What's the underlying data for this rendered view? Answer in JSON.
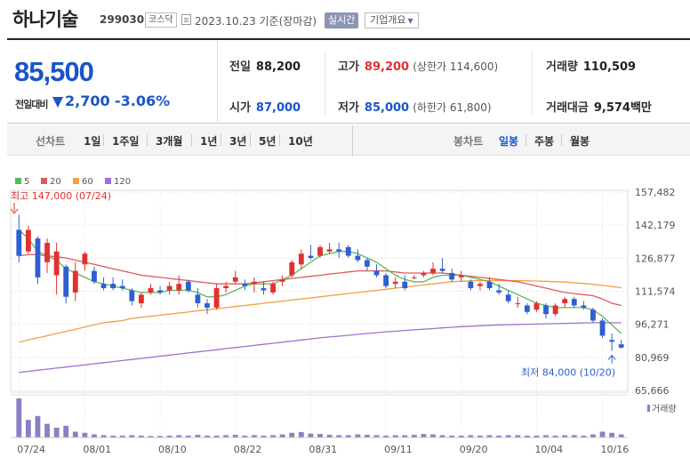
{
  "header": {
    "name": "하나기술",
    "code": "299030",
    "market": "코스닥",
    "date_text": "2023.10.23 기준(장마감)",
    "realtime_label": "실시간",
    "company_label": "기업개요"
  },
  "price": {
    "current": "85,500",
    "change_label": "전일대비",
    "change_abs": "2,700",
    "change_pct": "-3.06%"
  },
  "stats": {
    "prev_label": "전일",
    "prev_value": "88,200",
    "open_label": "시가",
    "open_value": "87,000",
    "high_label": "고가",
    "high_value": "89,200",
    "upper_limit": "(상한가 114,600)",
    "low_label": "저가",
    "low_value": "85,000",
    "lower_limit": "(하한가 61,800)",
    "volume_label": "거래량",
    "volume_value": "110,509",
    "amount_label": "거래대금",
    "amount_value": "9,574",
    "amount_unit": "백만"
  },
  "periods": {
    "line_label": "선차트",
    "line_options": [
      "1일",
      "1주일",
      "3개월",
      "1년",
      "3년",
      "5년",
      "10년"
    ],
    "candle_label": "봉차트",
    "candle_options": [
      "일봉",
      "주봉",
      "월봉"
    ],
    "active_candle": "일봉"
  },
  "colors": {
    "up": "#e23030",
    "down": "#2f5fd0",
    "ma5": "#5cb85c",
    "ma20": "#e05a5a",
    "ma60": "#f0a040",
    "ma120": "#a070d0",
    "volume": "#8b7fc4"
  },
  "chart_data": {
    "type": "candlestick",
    "legend": [
      {
        "name": "5",
        "color": "#5cb85c"
      },
      {
        "name": "20",
        "color": "#e05a5a"
      },
      {
        "name": "60",
        "color": "#f0a040"
      },
      {
        "name": "120",
        "color": "#a070d0"
      }
    ],
    "y_ticks": [
      157482,
      142179,
      126877,
      111574,
      96271,
      80969,
      65666
    ],
    "y_tick_labels": [
      "157,482",
      "142,179",
      "126,877",
      "111,574",
      "96,271",
      "80,969",
      "65,666"
    ],
    "ylim": [
      65666,
      157482
    ],
    "x_labels": [
      "07/24",
      "08/01",
      "08/10",
      "08/22",
      "08/31",
      "09/11",
      "09/20",
      "10/04",
      "10/16"
    ],
    "high_annotation": "최고 147,000 (07/24)",
    "low_annotation": "최저 84,000 (10/20)",
    "volume_label": "거래량",
    "candles": [
      [
        140000,
        147000,
        125000,
        128000
      ],
      [
        130000,
        142000,
        129000,
        140000
      ],
      [
        136000,
        137000,
        115000,
        118000
      ],
      [
        125000,
        136000,
        120000,
        134000
      ],
      [
        119000,
        134000,
        110000,
        130000
      ],
      [
        123000,
        124000,
        106000,
        109000
      ],
      [
        111000,
        125000,
        107000,
        121000
      ],
      [
        124000,
        130000,
        121000,
        129000
      ],
      [
        121000,
        123000,
        115000,
        116000
      ],
      [
        115000,
        118000,
        112000,
        113000
      ],
      [
        115000,
        118000,
        112000,
        113000
      ],
      [
        114000,
        117000,
        112000,
        113000
      ],
      [
        112000,
        113000,
        105000,
        107000
      ],
      [
        106000,
        111000,
        104000,
        110000
      ],
      [
        111000,
        115000,
        110000,
        113000
      ],
      [
        112000,
        114000,
        110000,
        111000
      ],
      [
        112000,
        116000,
        110000,
        114000
      ],
      [
        112000,
        119000,
        110000,
        115000
      ],
      [
        116000,
        117000,
        111000,
        112000
      ],
      [
        110000,
        113000,
        104000,
        106000
      ],
      [
        106000,
        108000,
        101000,
        104000
      ],
      [
        104000,
        115000,
        103000,
        113000
      ],
      [
        113000,
        116000,
        111000,
        114000
      ],
      [
        116000,
        121000,
        115000,
        118000
      ],
      [
        115000,
        117000,
        112000,
        114000
      ],
      [
        115000,
        118000,
        111000,
        116000
      ],
      [
        113000,
        116000,
        110000,
        112000
      ],
      [
        111000,
        116000,
        110000,
        115000
      ],
      [
        116000,
        119000,
        114000,
        117000
      ],
      [
        119000,
        126000,
        118000,
        125000
      ],
      [
        124000,
        131000,
        122000,
        129000
      ],
      [
        128000,
        133000,
        126000,
        127000
      ],
      [
        128000,
        133000,
        127000,
        132000
      ],
      [
        130000,
        134000,
        129000,
        131000
      ],
      [
        131000,
        134000,
        127000,
        130000
      ],
      [
        132000,
        133000,
        127000,
        128000
      ],
      [
        128000,
        131000,
        125000,
        126000
      ],
      [
        126000,
        127000,
        121000,
        123000
      ],
      [
        121000,
        124000,
        118000,
        119000
      ],
      [
        119000,
        120000,
        113000,
        114000
      ],
      [
        115000,
        118000,
        113000,
        116000
      ],
      [
        116000,
        119000,
        112000,
        113000
      ],
      [
        118000,
        119000,
        117000,
        118000
      ],
      [
        119000,
        121000,
        118000,
        120000
      ],
      [
        120000,
        125000,
        119000,
        122000
      ],
      [
        122000,
        127000,
        120000,
        121000
      ],
      [
        120000,
        122000,
        116000,
        117000
      ],
      [
        118000,
        121000,
        116000,
        119000
      ],
      [
        116000,
        117000,
        112000,
        113000
      ],
      [
        114000,
        116000,
        112000,
        115000
      ],
      [
        116000,
        118000,
        112000,
        113000
      ],
      [
        112000,
        115000,
        110000,
        111000
      ],
      [
        110000,
        112000,
        106000,
        107000
      ],
      [
        106000,
        109000,
        104000,
        106000
      ],
      [
        105000,
        106000,
        101000,
        102000
      ],
      [
        103000,
        107000,
        102000,
        106000
      ],
      [
        105000,
        106000,
        99000,
        101000
      ],
      [
        101000,
        106000,
        100000,
        105000
      ],
      [
        106000,
        109000,
        104000,
        108000
      ],
      [
        108000,
        109000,
        104000,
        105000
      ],
      [
        105000,
        107000,
        103000,
        104000
      ],
      [
        103000,
        104000,
        97000,
        98000
      ],
      [
        98000,
        99000,
        90000,
        91000
      ],
      [
        89000,
        92000,
        84000,
        88200
      ],
      [
        87000,
        89200,
        85000,
        85500
      ]
    ],
    "ma5": [
      140000,
      136000,
      130000,
      128000,
      126000,
      122000,
      120000,
      118000,
      116000,
      115000,
      114000,
      113000,
      112000,
      111000,
      111000,
      111000,
      112000,
      112000,
      112000,
      111000,
      109000,
      109000,
      110000,
      112000,
      114000,
      115000,
      115000,
      115000,
      117000,
      119000,
      122000,
      125000,
      128000,
      129000,
      130000,
      130000,
      129000,
      127000,
      125000,
      122000,
      119000,
      117000,
      116000,
      116000,
      118000,
      119000,
      119000,
      119000,
      118000,
      117000,
      116000,
      114000,
      112000,
      110000,
      108000,
      106000,
      105000,
      104000,
      104000,
      104000,
      104000,
      103000,
      100000,
      96000,
      92000
    ],
    "ma20": [
      128000,
      128500,
      128500,
      128000,
      127500,
      127000,
      126000,
      125000,
      124000,
      123000,
      122000,
      121000,
      120000,
      119000,
      118500,
      118000,
      117500,
      117000,
      116500,
      116000,
      115500,
      115000,
      115000,
      115000,
      115000,
      115500,
      116000,
      116500,
      117000,
      117500,
      118000,
      118500,
      119000,
      119500,
      120000,
      120500,
      121000,
      121000,
      121000,
      121000,
      120500,
      120000,
      120000,
      120000,
      120000,
      120000,
      119500,
      119000,
      118500,
      118000,
      117500,
      117000,
      116500,
      116000,
      115000,
      114000,
      113000,
      112000,
      111000,
      110500,
      110000,
      109500,
      108000,
      106000,
      105000
    ],
    "ma60": [
      88000,
      89000,
      90000,
      91000,
      92000,
      93000,
      94000,
      95000,
      96000,
      97000,
      97500,
      98000,
      99000,
      99500,
      100000,
      100500,
      101000,
      101500,
      102000,
      102500,
      103000,
      103500,
      104000,
      104500,
      105000,
      105500,
      106000,
      106500,
      107000,
      107500,
      108000,
      108500,
      109000,
      109500,
      110000,
      110500,
      111000,
      111500,
      112000,
      112500,
      113000,
      113500,
      114000,
      114500,
      115000,
      115500,
      116000,
      116200,
      116400,
      116500,
      116500,
      116500,
      116500,
      116500,
      116400,
      116300,
      116200,
      116000,
      115800,
      115500,
      115200,
      114800,
      114300,
      113800,
      113200
    ],
    "ma120": [
      74000,
      74500,
      75000,
      75500,
      76000,
      76500,
      77000,
      77500,
      78000,
      78500,
      79000,
      79500,
      80000,
      80500,
      81000,
      81500,
      82000,
      82500,
      83000,
      83500,
      84000,
      84500,
      85000,
      85500,
      86000,
      86500,
      87000,
      87500,
      88000,
      88500,
      89000,
      89500,
      90000,
      90400,
      90800,
      91200,
      91600,
      92000,
      92400,
      92800,
      93100,
      93400,
      93700,
      94000,
      94300,
      94600,
      94900,
      95200,
      95400,
      95600,
      95800,
      96000,
      96100,
      96200,
      96300,
      96400,
      96500,
      96600,
      96700,
      96800,
      96900,
      97000,
      97000,
      97000,
      97000
    ],
    "volume": [
      100,
      45,
      55,
      35,
      25,
      30,
      15,
      12,
      8,
      6,
      5,
      5,
      6,
      5,
      4,
      4,
      5,
      6,
      5,
      7,
      5,
      5,
      6,
      7,
      5,
      6,
      5,
      6,
      8,
      12,
      14,
      10,
      9,
      7,
      6,
      6,
      8,
      7,
      6,
      5,
      6,
      6,
      7,
      9,
      8,
      6,
      5,
      5,
      6,
      5,
      6,
      5,
      6,
      6,
      5,
      5,
      6,
      5,
      6,
      6,
      5,
      8,
      15,
      12,
      8
    ]
  }
}
